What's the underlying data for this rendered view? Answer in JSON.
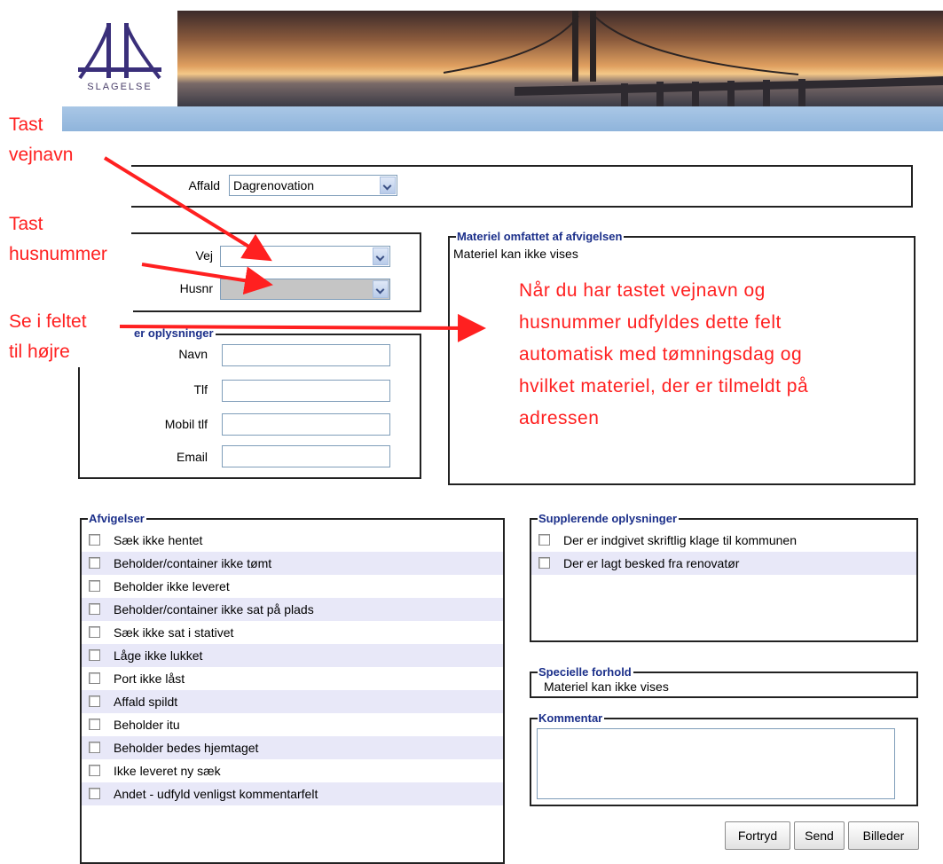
{
  "header": {
    "logo_text": "SLAGELSE"
  },
  "affald": {
    "label": "Affald",
    "value": "Dagrenovation"
  },
  "address": {
    "vej_label": "Vej",
    "vej_value": "",
    "husnr_label": "Husnr",
    "husnr_value": ""
  },
  "contact": {
    "legend": "er oplysninger",
    "navn_label": "Navn",
    "tlf_label": "Tlf",
    "mobil_label": "Mobil tlf",
    "email_label": "Email"
  },
  "materiel": {
    "legend": "Materiel omfattet af afvigelsen",
    "text": "Materiel kan ikke vises"
  },
  "afvigelser": {
    "legend": "Afvigelser",
    "items": [
      "Sæk ikke hentet",
      "Beholder/container ikke tømt",
      "Beholder ikke leveret",
      "Beholder/container ikke sat på plads",
      "Sæk ikke sat i stativet",
      "Låge ikke lukket",
      "Port ikke låst",
      "Affald spildt",
      "Beholder itu",
      "Beholder bedes hjemtaget",
      "Ikke leveret ny sæk",
      "Andet - udfyld venligst kommentarfelt"
    ]
  },
  "supplerende": {
    "legend": "Supplerende oplysninger",
    "items": [
      "Der er indgivet skriftlig klage til kommunen",
      "Der er lagt besked fra renovatør"
    ]
  },
  "specielle": {
    "legend": "Specielle forhold",
    "text": "Materiel kan ikke vises"
  },
  "kommentar": {
    "legend": "Kommentar",
    "value": ""
  },
  "buttons": {
    "fortryd": "Fortryd",
    "send": "Send",
    "billeder": "Billeder"
  },
  "annotations": {
    "tast_vejnavn_1": "Tast",
    "tast_vejnavn_2": "vejnavn",
    "tast_husnummer_1": "Tast",
    "tast_husnummer_2": "husnummer",
    "se_feltet_1": "Se i feltet",
    "se_feltet_2": "til højre",
    "info_lines": [
      "Når du har tastet vejnavn og",
      "husnummer udfyldes dette felt",
      "automatisk med tømningsdag og",
      "hvilket materiel, der er tilmeldt på",
      "adressen"
    ]
  },
  "colors": {
    "annotation": "#ff2020",
    "legend": "#1b2f8a",
    "menu_bar": "#a9c7e6"
  }
}
